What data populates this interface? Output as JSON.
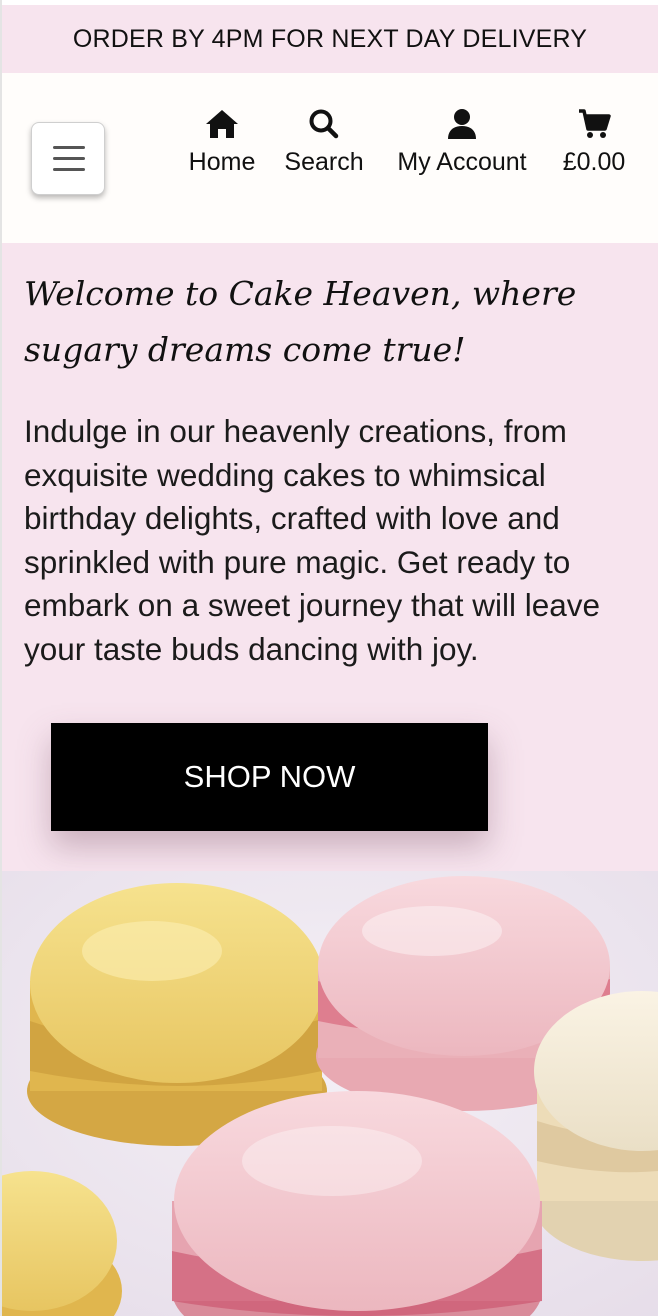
{
  "announcement": "ORDER BY 4PM FOR NEXT DAY DELIVERY",
  "nav": {
    "menu_icon": "hamburger-menu-icon",
    "items": [
      {
        "label": "Home",
        "icon": "home-icon"
      },
      {
        "label": "Search",
        "icon": "search-icon"
      },
      {
        "label": "My Account",
        "icon": "user-icon"
      },
      {
        "label": "£0.00",
        "icon": "cart-icon"
      }
    ]
  },
  "hero": {
    "heading": "Welcome to Cake Heaven, where sugary dreams come true!",
    "body": "Indulge in our heavenly creations, from exquisite wedding cakes to whimsical birthday delights, crafted with love and sprinkled with pure magic. Get ready to embark on a sweet journey that will leave your taste buds dancing with joy.",
    "cta_label": "SHOP NOW"
  },
  "colors": {
    "banner_pink": "#f7e4ee",
    "cta_black": "#000000",
    "macaron_yellow": "#f2d77a",
    "macaron_pink": "#f4c7cf",
    "macaron_cream": "#f5ecd8"
  }
}
